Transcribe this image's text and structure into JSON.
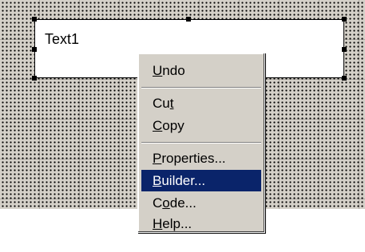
{
  "textbox": {
    "label": "Text1"
  },
  "menu": {
    "items": [
      {
        "label": "Undo",
        "mnemonic": "U",
        "rest": "ndo"
      },
      {
        "label": "Cut",
        "mnemonic": "t",
        "rest": "Cu"
      },
      {
        "label": "Copy",
        "mnemonic": "C",
        "rest": "opy"
      },
      {
        "label": "Properties...",
        "mnemonic": "P",
        "rest": "roperties..."
      },
      {
        "label": "Builder...",
        "mnemonic": "B",
        "rest": "uilder...",
        "active": true
      },
      {
        "label": "Code...",
        "mnemonic": "o",
        "rest": "de..."
      },
      {
        "label": "Help...",
        "mnemonic": "H",
        "rest": "elp..."
      }
    ]
  }
}
